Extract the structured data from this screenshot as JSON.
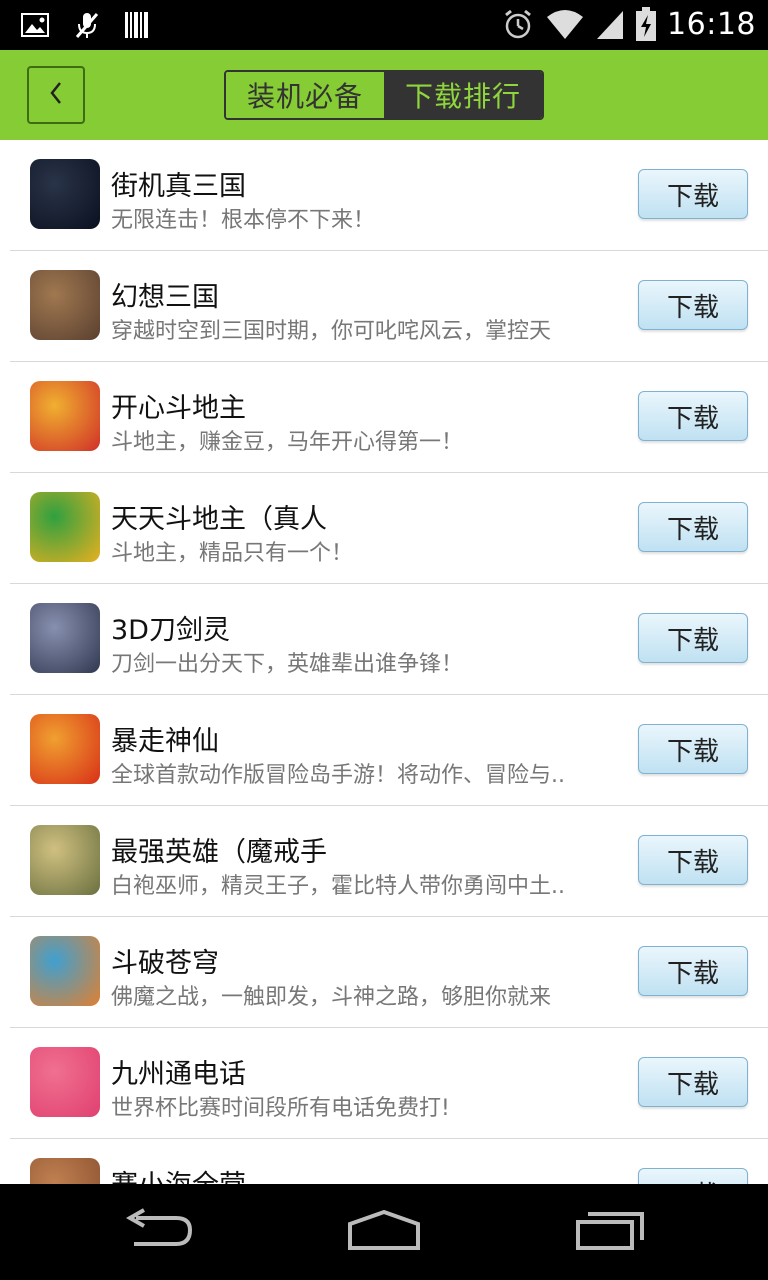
{
  "status_bar": {
    "time": "16:18",
    "left_icons": [
      "image-icon",
      "mic-off-icon",
      "barcode-icon"
    ],
    "right_icons": [
      "alarm-icon",
      "wifi-icon",
      "signal-icon",
      "battery-icon"
    ]
  },
  "header": {
    "tabs": [
      {
        "label": "装机必备",
        "active": false
      },
      {
        "label": "下载排行",
        "active": true
      }
    ]
  },
  "apps": [
    {
      "name": "街机真三国",
      "desc": "无限连击！根本停不下来！",
      "button": "下载",
      "icon_colors": [
        "#0a1020",
        "#2a3448"
      ]
    },
    {
      "name": "幻想三国",
      "desc": "穿越时空到三国时期，你可叱咤风云，掌控天",
      "button": "下载",
      "icon_colors": [
        "#5a4030",
        "#a07850"
      ]
    },
    {
      "name": "开心斗地主",
      "desc": "斗地主，赚金豆，马年开心得第一！",
      "button": "下载",
      "icon_colors": [
        "#d03028",
        "#f0b030"
      ]
    },
    {
      "name": "天天斗地主（真人",
      "desc": "斗地主，精品只有一个！",
      "button": "下载",
      "icon_colors": [
        "#e8b020",
        "#30a040"
      ]
    },
    {
      "name": "3D刀剑灵",
      "desc": "刀剑一出分天下，英雄辈出谁争锋！",
      "button": "下载",
      "icon_colors": [
        "#303850",
        "#8890b0"
      ]
    },
    {
      "name": "暴走神仙",
      "desc": "全球首款动作版冒险岛手游！将动作、冒险与..",
      "button": "下载",
      "icon_colors": [
        "#d83018",
        "#f0a030"
      ]
    },
    {
      "name": "最强英雄（魔戒手",
      "desc": "白袍巫师，精灵王子，霍比特人带你勇闯中土..",
      "button": "下载",
      "icon_colors": [
        "#6a7040",
        "#d0c080"
      ]
    },
    {
      "name": "斗破苍穹",
      "desc": "佛魔之战，一触即发，斗神之路，够胆你就来",
      "button": "下载",
      "icon_colors": [
        "#e08030",
        "#40a0d0"
      ]
    },
    {
      "name": "九州通电话",
      "desc": "世界杯比赛时间段所有电话免费打!",
      "button": "下载",
      "icon_colors": [
        "#e04070",
        "#f07090"
      ]
    },
    {
      "name": "赛小海全营",
      "desc": "",
      "button": "下载",
      "icon_colors": [
        "#8a5030",
        "#c08050"
      ]
    }
  ],
  "nav_bar": {
    "icons": [
      "back-icon",
      "home-icon",
      "recent-apps-icon"
    ]
  }
}
